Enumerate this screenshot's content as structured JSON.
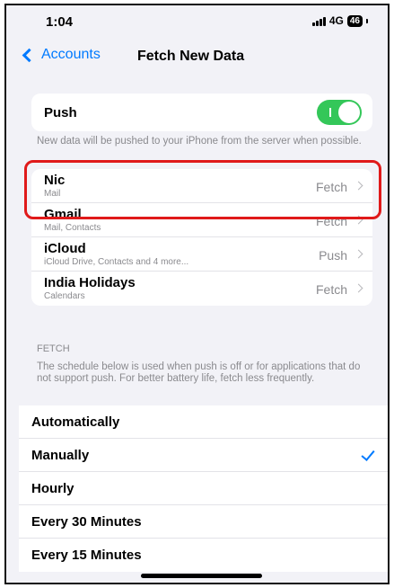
{
  "status": {
    "time": "1:04",
    "network": "4G",
    "battery": "46"
  },
  "nav": {
    "back_label": "Accounts",
    "title": "Fetch New Data"
  },
  "push": {
    "label": "Push",
    "enabled": true,
    "footnote": "New data will be pushed to your iPhone from the server when possible."
  },
  "accounts": [
    {
      "name": "Nic",
      "subtitle": "Mail",
      "value": "Fetch"
    },
    {
      "name": "Gmail",
      "subtitle": "Mail, Contacts",
      "value": "Fetch"
    },
    {
      "name": "iCloud",
      "subtitle": "iCloud Drive, Contacts and 4 more...",
      "value": "Push"
    },
    {
      "name": "India Holidays",
      "subtitle": "Calendars",
      "value": "Fetch"
    }
  ],
  "fetch": {
    "header": "FETCH",
    "footnote": "The schedule below is used when push is off or for applications that do not support push. For better battery life, fetch less frequently.",
    "options": [
      "Automatically",
      "Manually",
      "Hourly",
      "Every 30 Minutes",
      "Every 15 Minutes"
    ],
    "selected": "Manually"
  },
  "colors": {
    "accent": "#007aff",
    "toggle_on": "#34c759",
    "highlight": "#e01a1a"
  }
}
